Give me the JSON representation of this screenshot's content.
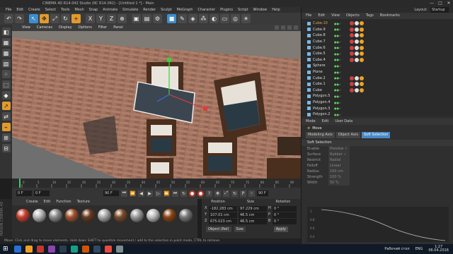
{
  "window": {
    "title": "CINEMA 4D R14.042 Studio (RC R14.042) - [Untitled 1 *] - Main",
    "controls": [
      "—",
      "□",
      "✕"
    ]
  },
  "menubar": [
    "File",
    "Edit",
    "Create",
    "Select",
    "Tools",
    "Mesh",
    "Snap",
    "Animate",
    "Simulate",
    "Render",
    "Sculpt",
    "MoGraph",
    "Character",
    "Plugins",
    "Script",
    "Window",
    "Help"
  ],
  "toolbar": {
    "undo": "↶",
    "redo": "↷",
    "x": "X",
    "y": "Y",
    "z": "Z"
  },
  "viewport": {
    "menu": [
      "View",
      "Cameras",
      "Display",
      "Options",
      "Filter",
      "Panel"
    ]
  },
  "timeline": {
    "ticks": [
      "0",
      "5",
      "10",
      "15",
      "20",
      "25",
      "30",
      "35",
      "40",
      "45",
      "50",
      "55",
      "60",
      "65",
      "70",
      "75",
      "80",
      "85",
      "90"
    ],
    "frame_end": "0 F",
    "start": "0 F",
    "current": "0 F",
    "end": "90 F",
    "max": "90 F"
  },
  "materials": {
    "menu": [
      "Create",
      "Edit",
      "Function",
      "Texture"
    ],
    "balls": [
      "#c8402e",
      "#b8b8b8",
      "#8a8a8a",
      "#a0522d",
      "#6b3a1e",
      "#a9a9a9",
      "#7a4a2a",
      "#9a9a9a",
      "#bfbfbf",
      "#8b4513",
      "#777777"
    ]
  },
  "coordinates": {
    "headers": [
      "Position",
      "Size",
      "Rotation"
    ],
    "rows": [
      {
        "axis": "X",
        "pos": "-182.283 cm",
        "size": "97.229 cm",
        "rot_axis": "H",
        "rot": "0 °"
      },
      {
        "axis": "Y",
        "pos": "107.01 cm",
        "size": "46.5 cm",
        "rot_axis": "P",
        "rot": "0 °"
      },
      {
        "axis": "Z",
        "pos": "675.023 cm",
        "size": "46.5 cm",
        "rot_axis": "B",
        "rot": "0 °"
      }
    ],
    "mode": "Object (Rel)",
    "size_mode": "Size",
    "apply": "Apply"
  },
  "status": "Move: Click and drag to move elements. Hold down SHIFT to quantize movement / add to the selection in point mode, CTRL to remove.",
  "right": {
    "layout_label": "Layout:",
    "layout_value": "Startup",
    "om_menu": [
      "File",
      "Edit",
      "View",
      "Objects",
      "Tags",
      "Bookmarks"
    ],
    "objects": [
      {
        "name": "Cube.10",
        "sel": true
      },
      {
        "name": "Cube.9",
        "sel": false
      },
      {
        "name": "Cube.8",
        "sel": false
      },
      {
        "name": "Cube.7",
        "sel": false
      },
      {
        "name": "Cube.6",
        "sel": false
      },
      {
        "name": "Cube.5",
        "sel": false
      },
      {
        "name": "Cube.4",
        "sel": false
      },
      {
        "name": "Sphere",
        "sel": false
      },
      {
        "name": "Plane",
        "sel": false
      },
      {
        "name": "Cube.2",
        "sel": false
      },
      {
        "name": "Cube.1",
        "sel": false
      },
      {
        "name": "Cube",
        "sel": false
      },
      {
        "name": "Polygon.5",
        "sel": false
      },
      {
        "name": "Polygon.4",
        "sel": false
      },
      {
        "name": "Polygon.3",
        "sel": false
      },
      {
        "name": "Polygon.2",
        "sel": false
      }
    ],
    "attr_menu": [
      "Mode",
      "Edit",
      "User Data"
    ],
    "attr_title": "Move",
    "attr_tabs": [
      "Modeling Axis",
      "Object Axis",
      "Soft Selection"
    ],
    "section": "Soft Selection",
    "props": [
      {
        "k": "Enable",
        "v": "Preview ✓"
      },
      {
        "k": "Surface",
        "v": "Rubber ✓"
      },
      {
        "k": "Restrict",
        "v": "Radial"
      },
      {
        "k": "Falloff",
        "v": "Linear"
      },
      {
        "k": "Radius",
        "v": "100 cm"
      },
      {
        "k": "Strength",
        "v": "100 %"
      },
      {
        "k": "Width",
        "v": "50 %"
      }
    ],
    "graph_labels": [
      "1",
      "0.8",
      "0.6",
      "0.4"
    ]
  },
  "taskbar": {
    "apps": [
      "#2a6fd6",
      "#f0a020",
      "#c0392b",
      "#8e44ad",
      "#2c3e50",
      "#16a085",
      "#d35400",
      "#34495e",
      "#e74c3c",
      "#7f8c8d"
    ],
    "desktop": "Рабочий стол",
    "lang": "ENG",
    "time": "1:27",
    "date": "06.04.2016"
  }
}
